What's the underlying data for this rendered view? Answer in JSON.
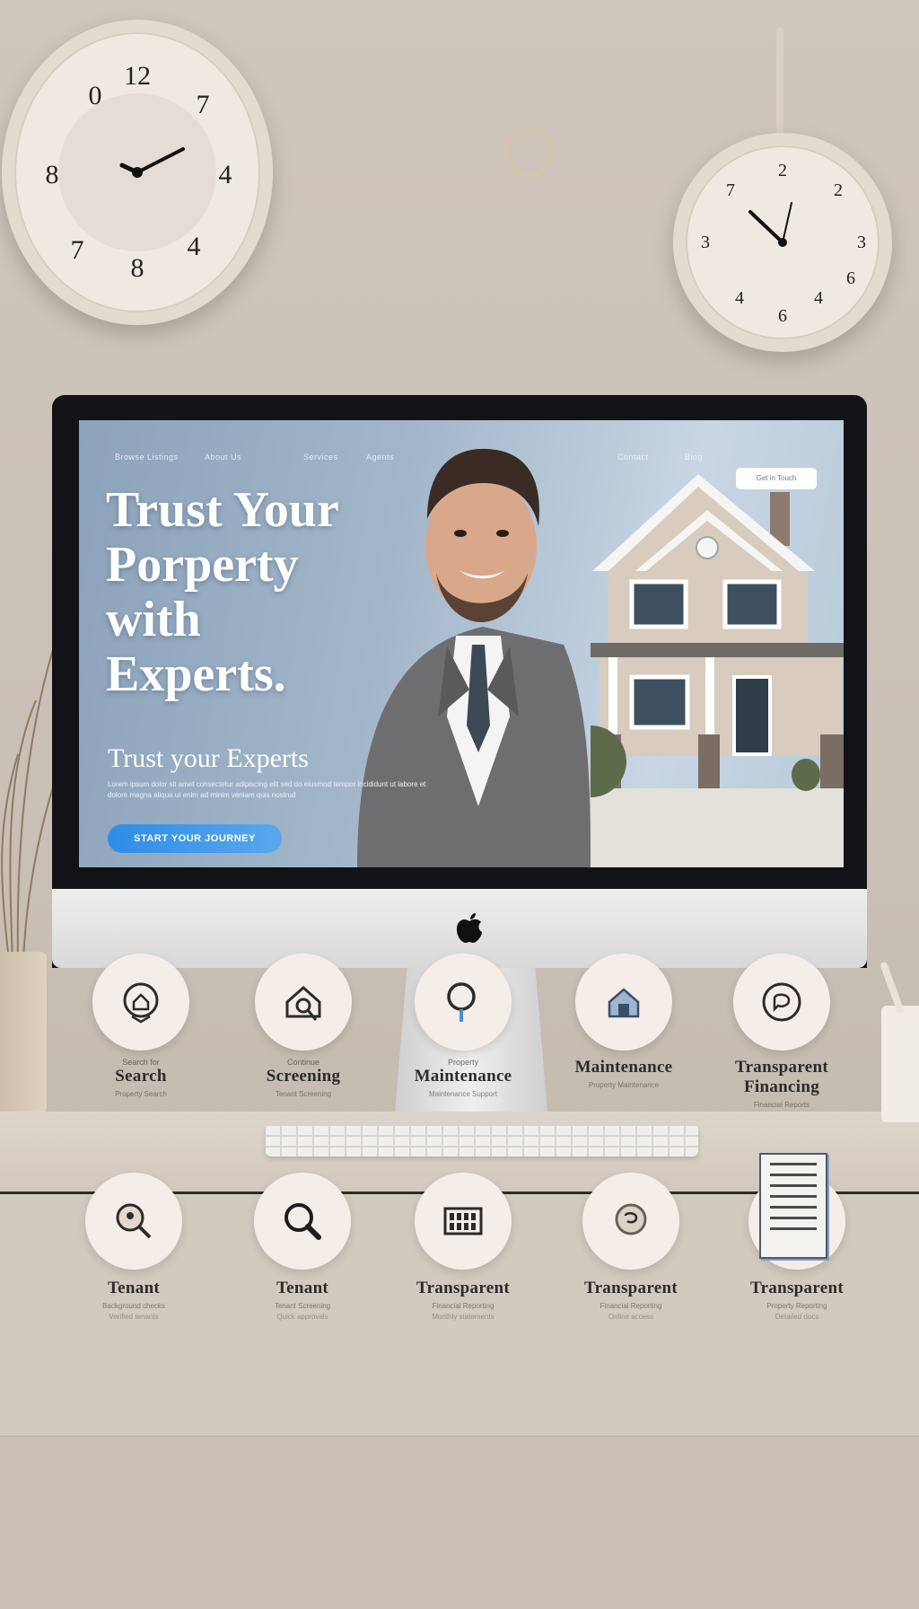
{
  "screen": {
    "nav": {
      "links": [
        "Browse Listings",
        "About Us",
        "Services",
        "Agents",
        "Contact",
        "Blog"
      ],
      "cta": "Get in Touch"
    },
    "hero": {
      "title_lines": [
        "Trust Your",
        "Porperty",
        "with",
        "Experts."
      ],
      "subtitle": "Trust your Experts",
      "description": "Lorem ipsum dolor sit amet consectetur adipiscing elit sed do eiusmod tempor incididunt ut labore et dolore magna aliqua ut enim ad minim veniam quis nostrud",
      "button": "START YOUR JOURNEY"
    }
  },
  "services_row1": [
    {
      "small": "Search for",
      "title": "Search",
      "sub": "Property Search",
      "icon": "house-pin-icon"
    },
    {
      "small": "Continue",
      "title": "Screening",
      "sub": "Tenant Screening",
      "icon": "house-search-icon"
    },
    {
      "small": "Property",
      "title": "Maintenance",
      "sub": "Maintenance Support",
      "icon": "magnifier-icon"
    },
    {
      "small": "",
      "title": "Maintenance",
      "sub": "Property Maintenance",
      "icon": "house-gear-icon"
    },
    {
      "small": "",
      "title": "Transparent Financing",
      "sub": "Financial Reports",
      "icon": "chat-icon"
    }
  ],
  "services_row2": [
    {
      "title": "Tenant",
      "sub": "Background checks",
      "sub2": "Verified tenants",
      "icon": "search-pin-icon"
    },
    {
      "title": "Tenant",
      "sub": "Tenant Screening",
      "sub2": "Quick approvals",
      "icon": "magnifier-icon"
    },
    {
      "title": "Transparent",
      "sub": "Financial Reporting",
      "sub2": "Monthly statements",
      "icon": "building-icon"
    },
    {
      "title": "Transparent",
      "sub": "Financial Reporting",
      "sub2": "Online access",
      "icon": "chat-icon"
    },
    {
      "title": "Transparent",
      "sub": "Property Reporting",
      "sub2": "Detailed docs",
      "icon": "document-icon"
    }
  ],
  "colors": {
    "screen_bg": "#8ba3bb",
    "button": "#2e8de6",
    "wall": "#cfc6bd"
  }
}
